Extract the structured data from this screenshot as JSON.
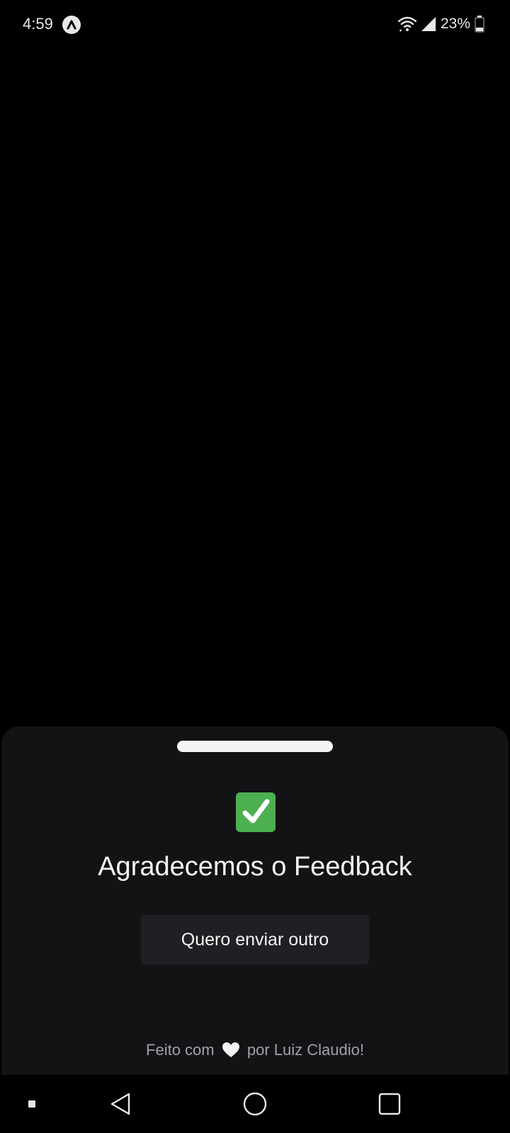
{
  "status_bar": {
    "time": "4:59",
    "app_icon": "expo-icon",
    "wifi_icon": "wifi-icon",
    "signal_icon": "cell-signal-icon",
    "battery_percent": "23%",
    "battery_icon": "battery-icon"
  },
  "sheet": {
    "success_icon": "check-mark-icon",
    "title": "Agradecemos o Feedback",
    "button_label": "Quero enviar outro",
    "footer_prefix": "Feito com",
    "footer_heart_icon": "heart-icon",
    "footer_suffix": "por Luiz Claudio!"
  },
  "nav_bar": {
    "items": [
      "menu-dot-icon",
      "back-icon",
      "home-icon",
      "recents-icon"
    ]
  },
  "colors": {
    "background": "#000000",
    "sheet": "#131315",
    "button": "#202024",
    "text_primary": "#f4f4f5",
    "text_secondary": "#a1a1aa",
    "success": "#4caf50"
  }
}
